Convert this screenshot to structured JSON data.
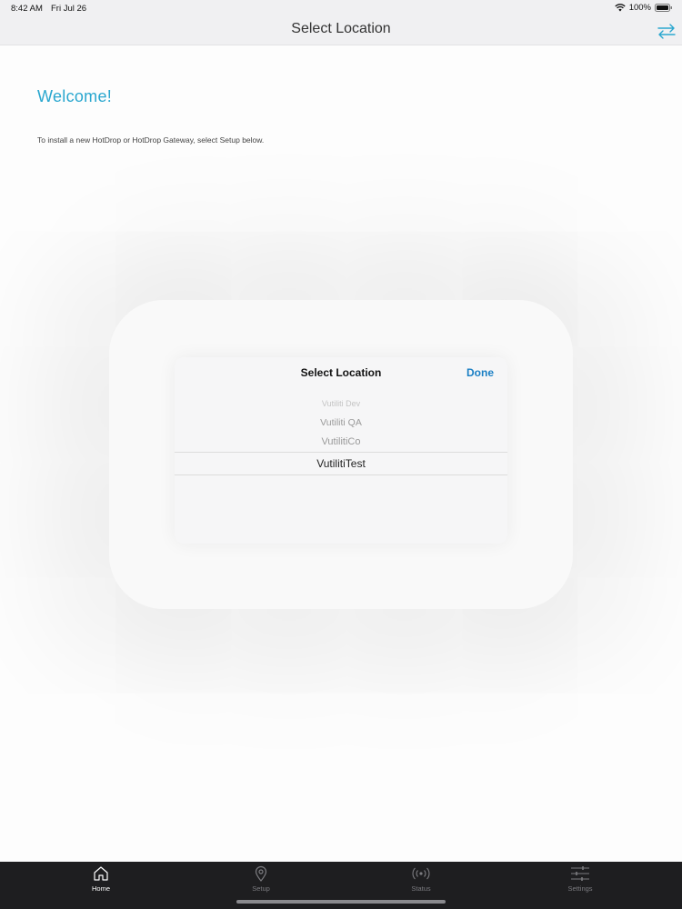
{
  "status_bar": {
    "time": "8:42 AM",
    "date": "Fri Jul 26",
    "battery": "100%"
  },
  "nav": {
    "title": "Select Location",
    "swap_icon": "swap-arrows-icon"
  },
  "content": {
    "welcome_title": "Welcome!",
    "welcome_text": "To install a new HotDrop or HotDrop Gateway, select Setup below."
  },
  "popover": {
    "title": "Select Location",
    "done_label": "Done",
    "options": [
      "Vutiliti Dev",
      "Vutiliti QA",
      "VutilitiCo",
      "VutilitiTest"
    ],
    "selected": "VutilitiTest"
  },
  "tabs": [
    {
      "label": "Home",
      "icon": "home-icon",
      "active": true
    },
    {
      "label": "Setup",
      "icon": "location-pin-icon",
      "active": false
    },
    {
      "label": "Status",
      "icon": "broadcast-icon",
      "active": false
    },
    {
      "label": "Settings",
      "icon": "sliders-icon",
      "active": false
    }
  ],
  "colors": {
    "accent": "#2aa7cf",
    "done": "#1a7fc4",
    "tab_bar": "#1e1e20"
  }
}
